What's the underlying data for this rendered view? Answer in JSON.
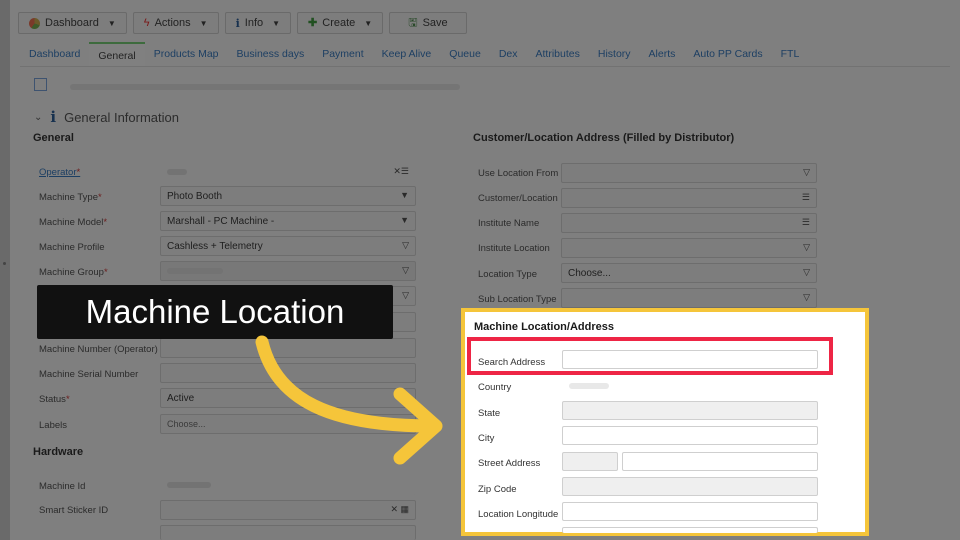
{
  "toolbar": {
    "dashboard": "Dashboard",
    "actions": "Actions",
    "info": "Info",
    "create": "Create",
    "save": "Save"
  },
  "tabs": [
    "Dashboard",
    "General",
    "Products Map",
    "Business days",
    "Payment",
    "Keep Alive",
    "Queue",
    "Dex",
    "Attributes",
    "History",
    "Alerts",
    "Auto PP Cards",
    "FTL"
  ],
  "section_title": "General Information",
  "general": {
    "title": "General",
    "fields": {
      "operator": "Operator",
      "machine_type": "Machine Type",
      "machine_type_value": "Photo Booth",
      "machine_model": "Machine Model",
      "machine_model_value": "Marshall - PC Machine -",
      "machine_profile": "Machine Profile",
      "machine_profile_value": "Cashless + Telemetry",
      "machine_group": "Machine Group",
      "machine_number": "Machine Number (Operator)",
      "machine_serial": "Machine Serial Number",
      "status": "Status",
      "status_value": "Active",
      "labels": "Labels",
      "labels_placeholder": "Choose..."
    },
    "required_mark": "*"
  },
  "hardware": {
    "title": "Hardware",
    "machine_id": "Machine Id",
    "smart_sticker": "Smart Sticker ID"
  },
  "customer": {
    "title": "Customer/Location Address (Filled by Distributor)",
    "use_location_from": "Use Location From",
    "customer_location": "Customer/Location",
    "institute_name": "Institute Name",
    "institute_location": "Institute Location",
    "location_type": "Location Type",
    "location_type_value": "Choose...",
    "sub_location_type": "Sub Location Type"
  },
  "machine_location": {
    "title": "Machine Location/Address",
    "search_address": "Search Address",
    "country": "Country",
    "state": "State",
    "city": "City",
    "street_address": "Street Address",
    "zip_code": "Zip Code",
    "location_longitude": "Location Longitude"
  },
  "callout": {
    "text": "Machine Location"
  },
  "colors": {
    "highlight_panel": "#f5c53a",
    "search_highlight": "#ee2545",
    "arrow": "#f5c53a",
    "callout_bg": "#111111"
  }
}
